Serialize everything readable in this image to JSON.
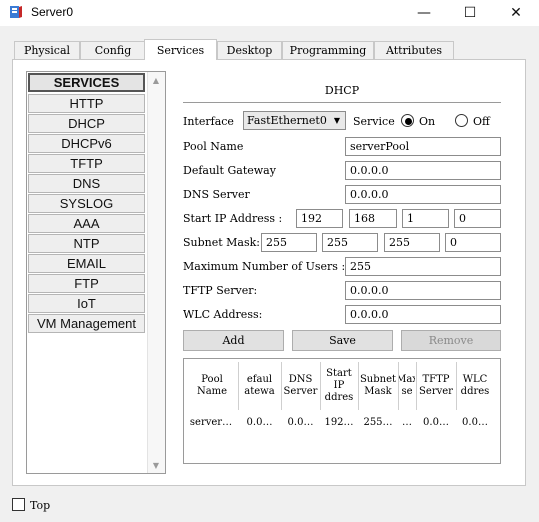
{
  "window": {
    "title": "Server0",
    "minimize": "—",
    "maximize": "☐",
    "close": "✕"
  },
  "tabs": [
    "Physical",
    "Config",
    "Services",
    "Desktop",
    "Programming",
    "Attributes"
  ],
  "services": {
    "header": "SERVICES",
    "items": [
      "HTTP",
      "DHCP",
      "DHCPv6",
      "TFTP",
      "DNS",
      "SYSLOG",
      "AAA",
      "NTP",
      "EMAIL",
      "FTP",
      "IoT",
      "VM Management"
    ],
    "scroll_up": "▲",
    "scroll_down": "▼"
  },
  "dhcp": {
    "title": "DHCP",
    "interface_label": "Interface",
    "interface_value": "FastEthernet0",
    "service_label": "Service",
    "on_label": "On",
    "off_label": "Off",
    "pool_name_label": "Pool Name",
    "pool_name_value": "serverPool",
    "gateway_label": "Default Gateway",
    "gateway_value": "0.0.0.0",
    "dns_label": "DNS Server",
    "dns_value": "0.0.0.0",
    "start_ip_label": "Start IP Address :",
    "start_ip": [
      "192",
      "168",
      "1",
      "0"
    ],
    "subnet_label": "Subnet Mask:",
    "subnet": [
      "255",
      "255",
      "255",
      "0"
    ],
    "max_users_label": "Maximum Number of Users :",
    "max_users_value": "255",
    "tftp_label": "TFTP Server:",
    "tftp_value": "0.0.0.0",
    "wlc_label": "WLC Address:",
    "wlc_value": "0.0.0.0",
    "add_label": "Add",
    "save_label": "Save",
    "remove_label": "Remove"
  },
  "pool_table": {
    "headers": [
      [
        "Pool",
        "Name"
      ],
      [
        "efaul",
        "atewa"
      ],
      [
        "DNS",
        "Server"
      ],
      [
        "Start",
        "IP",
        "ddres"
      ],
      [
        "Subnet",
        "Mask"
      ],
      [
        "Max",
        "se"
      ],
      [
        "TFTP",
        "Server"
      ],
      [
        "WLC",
        "ddres"
      ]
    ],
    "row": [
      "server…",
      "0.0…",
      "0.0…",
      "192…",
      "255…",
      "…",
      "0.0…",
      "0.0…"
    ]
  },
  "bottom": {
    "top_label": "Top"
  }
}
